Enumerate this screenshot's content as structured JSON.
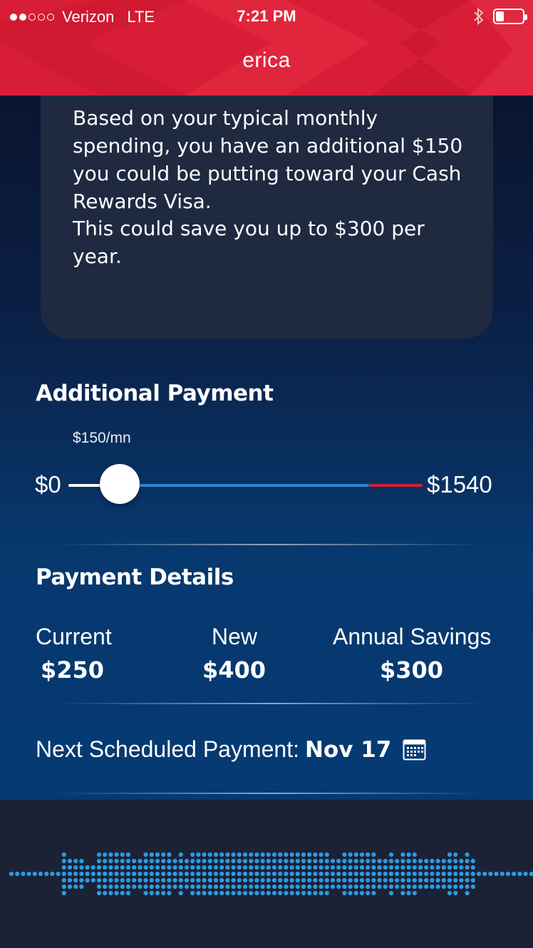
{
  "status_bar": {
    "carrier": "Verizon",
    "network": "LTE",
    "time": "7:21 PM",
    "signal_bars_filled": 2,
    "signal_bars_total": 5,
    "battery_level": 0.3,
    "bluetooth_icon": "bluetooth-icon"
  },
  "header": {
    "title": "erica"
  },
  "message": {
    "paragraph1": "Based on your typical monthly spending, you have an additional $150 you could be putting toward your Cash Rewards Visa.",
    "paragraph2": "This could save you up to $300 per year."
  },
  "additional_payment": {
    "title": "Additional Payment",
    "current_value_label": "$150/mn",
    "min_label": "$0",
    "max_label": "$1540",
    "value": 150,
    "min": 0,
    "max": 1540
  },
  "payment_details": {
    "title": "Payment Details",
    "current_label": "Current",
    "current_value": "$250",
    "new_label": "New",
    "new_value": "$400",
    "annual_label": "Annual Savings",
    "annual_value": "$300"
  },
  "next_payment": {
    "label": "Next Scheduled Payment:",
    "date": "Nov 17",
    "icon": "calendar-icon"
  },
  "colors": {
    "header_red": "#d81e36",
    "accent_blue": "#2f86d6",
    "bubble_bg": "#1f2a41",
    "voice_bg": "#1b2236",
    "wave_dot": "#2d9ae0"
  }
}
